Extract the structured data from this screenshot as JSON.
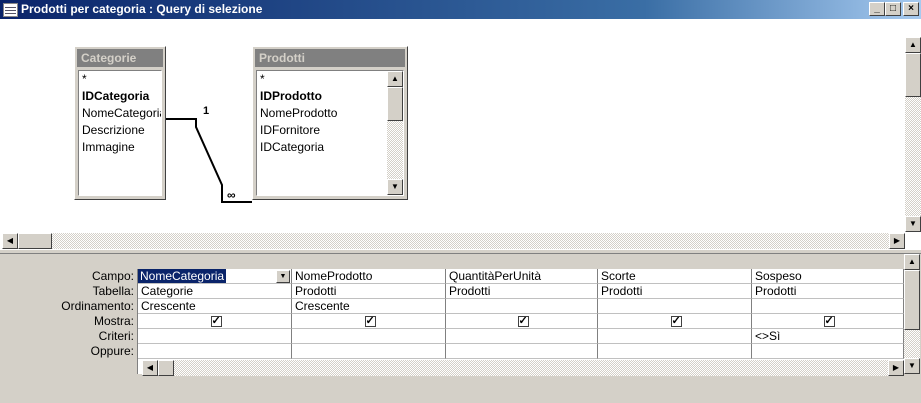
{
  "window": {
    "title": "Prodotti per categoria : Query di selezione",
    "minimize": "_",
    "maximize": "□",
    "close": "×"
  },
  "tables": [
    {
      "name": "Categorie",
      "fields": [
        "*",
        "IDCategoria",
        "NomeCategoria",
        "Descrizione",
        "Immagine"
      ],
      "key_field": "IDCategoria"
    },
    {
      "name": "Prodotti",
      "fields": [
        "*",
        "IDProdotto",
        "NomeProdotto",
        "IDFornitore",
        "IDCategoria"
      ],
      "key_field": "IDProdotto"
    }
  ],
  "relationship": {
    "one_label": "1",
    "many_label": "∞"
  },
  "grid": {
    "row_labels": [
      "Campo:",
      "Tabella:",
      "Ordinamento:",
      "Mostra:",
      "Criteri:",
      "Oppure:"
    ],
    "columns": [
      {
        "campo": "NomeCategoria",
        "tabella": "Categorie",
        "ordinamento": "Crescente",
        "mostra": true,
        "criteri": "",
        "selected": true
      },
      {
        "campo": "NomeProdotto",
        "tabella": "Prodotti",
        "ordinamento": "Crescente",
        "mostra": true,
        "criteri": ""
      },
      {
        "campo": "QuantitàPerUnità",
        "tabella": "Prodotti",
        "ordinamento": "",
        "mostra": true,
        "criteri": ""
      },
      {
        "campo": "Scorte",
        "tabella": "Prodotti",
        "ordinamento": "",
        "mostra": true,
        "criteri": ""
      },
      {
        "campo": "Sospeso",
        "tabella": "Prodotti",
        "ordinamento": "",
        "mostra": true,
        "criteri": "<>Sì"
      }
    ]
  }
}
